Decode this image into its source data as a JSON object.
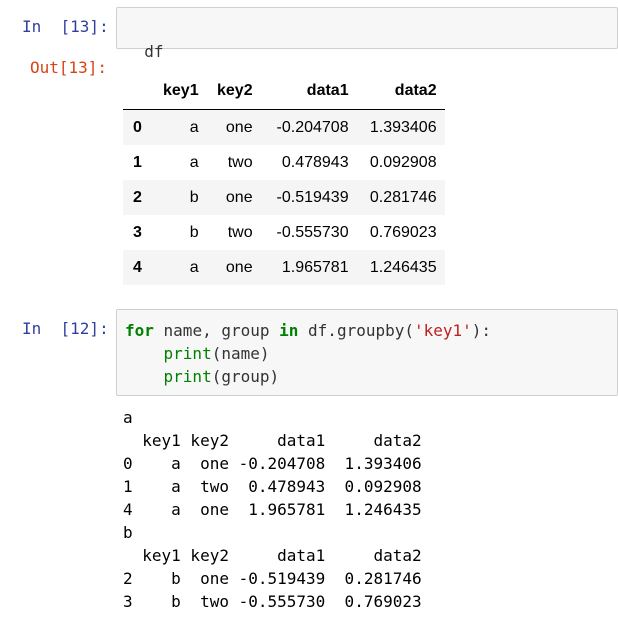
{
  "cell1": {
    "in_prompt": "In  [13]:",
    "code": "df",
    "out_prompt": "Out[13]:"
  },
  "dataframe": {
    "columns": [
      "key1",
      "key2",
      "data1",
      "data2"
    ],
    "rows": [
      {
        "index": "0",
        "key1": "a",
        "key2": "one",
        "data1": "-0.204708",
        "data2": "1.393406"
      },
      {
        "index": "1",
        "key1": "a",
        "key2": "two",
        "data1": "0.478943",
        "data2": "0.092908"
      },
      {
        "index": "2",
        "key1": "b",
        "key2": "one",
        "data1": "-0.519439",
        "data2": "0.281746"
      },
      {
        "index": "3",
        "key1": "b",
        "key2": "two",
        "data1": "-0.555730",
        "data2": "0.769023"
      },
      {
        "index": "4",
        "key1": "a",
        "key2": "one",
        "data1": "1.965781",
        "data2": "1.246435"
      }
    ]
  },
  "cell2": {
    "in_prompt": "In  [12]:",
    "code": {
      "kw_for": "for",
      "t1": " name, group ",
      "kw_in": "in",
      "t2": " df.groupby(",
      "str_key": "'key1'",
      "t3": "):",
      "indent": "    ",
      "print1": "print",
      "arg1": "(name)",
      "print2": "print",
      "arg2": "(group)"
    },
    "output": [
      "a",
      "  key1 key2     data1     data2",
      "0    a  one -0.204708  1.393406",
      "1    a  two  0.478943  0.092908",
      "4    a  one  1.965781  1.246435",
      "b",
      "  key1 key2     data1     data2",
      "2    b  one -0.519439  0.281746",
      "3    b  two -0.555730  0.769023"
    ]
  }
}
